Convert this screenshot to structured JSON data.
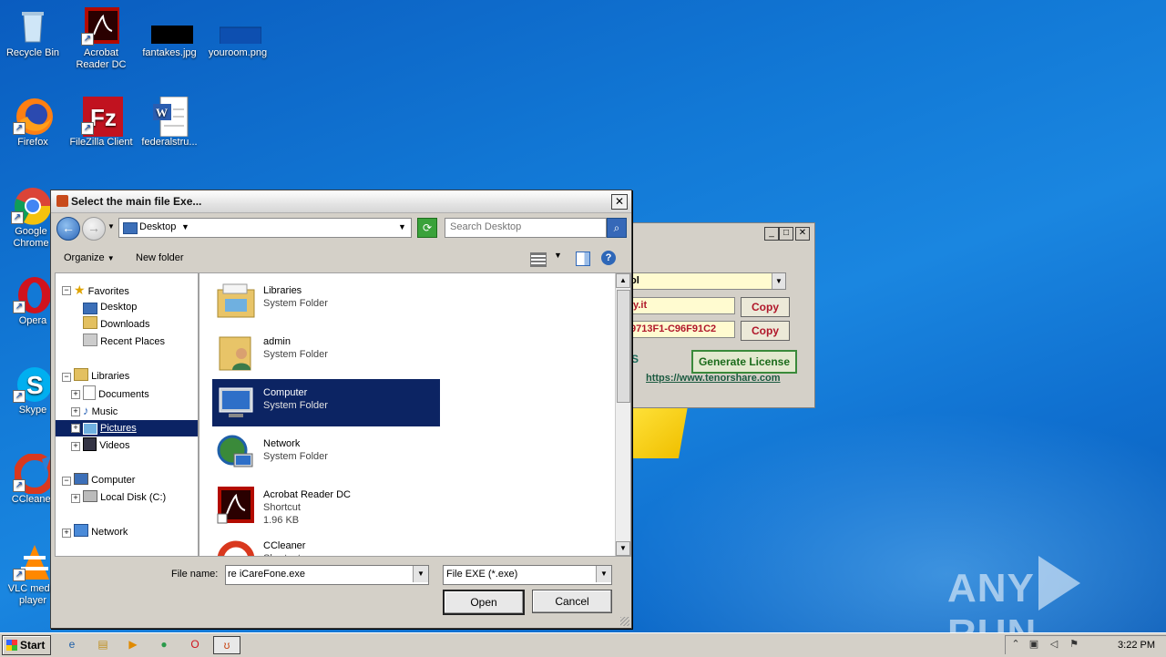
{
  "desktop": {
    "icons": [
      {
        "label": "Recycle Bin"
      },
      {
        "label": "Acrobat Reader DC"
      },
      {
        "label": "fantakes.jpg"
      },
      {
        "label": "youroom.png"
      },
      {
        "label": "Firefox"
      },
      {
        "label": "FileZilla Client"
      },
      {
        "label": "federalstru..."
      },
      {
        "label": "Google Chrome"
      },
      {
        "label": "Opera"
      },
      {
        "label": "Skype"
      },
      {
        "label": "CCleaner"
      },
      {
        "label": "VLC media player"
      }
    ]
  },
  "bg_app": {
    "dropdown_value": "ol",
    "field1": "ly.it",
    "field2": "9713F1-C96F91C2",
    "copy_label": "Copy",
    "generate_label": "Generate License",
    "link": "https://www.tenorshare.com",
    "partial_text": "S"
  },
  "dialog": {
    "title": "Select the main file Exe...",
    "address": "Desktop",
    "search_placeholder": "Search Desktop",
    "organize": "Organize",
    "new_folder": "New folder",
    "tree": {
      "favorites": "Favorites",
      "desktop": "Desktop",
      "downloads": "Downloads",
      "recent": "Recent Places",
      "libraries": "Libraries",
      "documents": "Documents",
      "music": "Music",
      "pictures": "Pictures",
      "videos": "Videos",
      "computer": "Computer",
      "local_disk": "Local Disk (C:)",
      "network": "Network"
    },
    "files": [
      {
        "name": "Libraries",
        "type": "System Folder"
      },
      {
        "name": "admin",
        "type": "System Folder"
      },
      {
        "name": "Computer",
        "type": "System Folder"
      },
      {
        "name": "Network",
        "type": "System Folder"
      },
      {
        "name": "Acrobat Reader DC",
        "type": "Shortcut",
        "size": "1.96 KB"
      },
      {
        "name": "CCleaner",
        "type": "Shortcut"
      }
    ],
    "file_name_label": "File name:",
    "file_name_value": "re iCareFone.exe",
    "filter": "File EXE (*.exe)",
    "open": "Open",
    "cancel": "Cancel"
  },
  "taskbar": {
    "start": "Start",
    "clock": "3:22 PM"
  },
  "watermark": {
    "left": "ANY",
    "right": "RUN"
  }
}
